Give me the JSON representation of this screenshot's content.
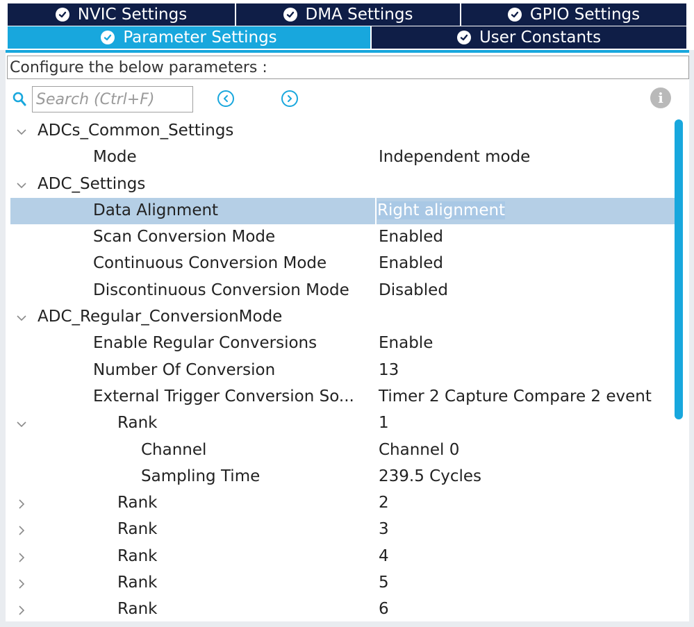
{
  "tabs": {
    "row1": [
      {
        "label": "NVIC Settings"
      },
      {
        "label": "DMA Settings"
      },
      {
        "label": "GPIO Settings"
      }
    ],
    "row2": [
      {
        "label": "Parameter Settings",
        "active": true
      },
      {
        "label": "User Constants"
      }
    ]
  },
  "panel": {
    "description": "Configure the below parameters :",
    "search_placeholder": "Search (Ctrl+F)"
  },
  "tree": [
    {
      "label": "ADCs_Common_Settings",
      "value": "",
      "twisty": "expanded",
      "level": 0
    },
    {
      "label": "Mode",
      "value": "Independent mode",
      "twisty": "none",
      "level": 2
    },
    {
      "label": "ADC_Settings",
      "value": "",
      "twisty": "expanded",
      "level": 0
    },
    {
      "label": "Data Alignment",
      "value": "Right alignment",
      "twisty": "none",
      "level": 2,
      "selected": true
    },
    {
      "label": "Scan Conversion Mode",
      "value": "Enabled",
      "twisty": "none",
      "level": 2
    },
    {
      "label": "Continuous Conversion Mode",
      "value": "Enabled",
      "twisty": "none",
      "level": 2
    },
    {
      "label": "Discontinuous Conversion Mode",
      "value": "Disabled",
      "twisty": "none",
      "level": 2
    },
    {
      "label": "ADC_Regular_ConversionMode",
      "value": "",
      "twisty": "expanded",
      "level": 0
    },
    {
      "label": "Enable Regular Conversions",
      "value": "Enable",
      "twisty": "none",
      "level": 2
    },
    {
      "label": "Number Of Conversion",
      "value": "13",
      "twisty": "none",
      "level": 2
    },
    {
      "label": "External Trigger Conversion So...",
      "value": "Timer 2 Capture Compare 2 event",
      "twisty": "none",
      "level": 2
    },
    {
      "label": "Rank",
      "value": "1",
      "twisty": "expanded",
      "level": 3
    },
    {
      "label": "Channel",
      "value": "Channel 0",
      "twisty": "none",
      "level": 4
    },
    {
      "label": "Sampling Time",
      "value": "239.5 Cycles",
      "twisty": "none",
      "level": 4
    },
    {
      "label": "Rank",
      "value": "2",
      "twisty": "collapsed",
      "level": 3
    },
    {
      "label": "Rank",
      "value": "3",
      "twisty": "collapsed",
      "level": 3
    },
    {
      "label": "Rank",
      "value": "4",
      "twisty": "collapsed",
      "level": 3
    },
    {
      "label": "Rank",
      "value": "5",
      "twisty": "collapsed",
      "level": 3
    },
    {
      "label": "Rank",
      "value": "6",
      "twisty": "collapsed",
      "level": 3
    }
  ],
  "colors": {
    "tab_dark": "#0f1e47",
    "tab_active": "#18a7dd",
    "selection": "#b5cfe6",
    "scrollbar": "#18a7dd"
  },
  "icons": [
    "check-circle-icon",
    "search-icon",
    "prev-arrow-icon",
    "next-arrow-icon",
    "info-icon",
    "chevron-down-icon",
    "chevron-right-icon"
  ]
}
